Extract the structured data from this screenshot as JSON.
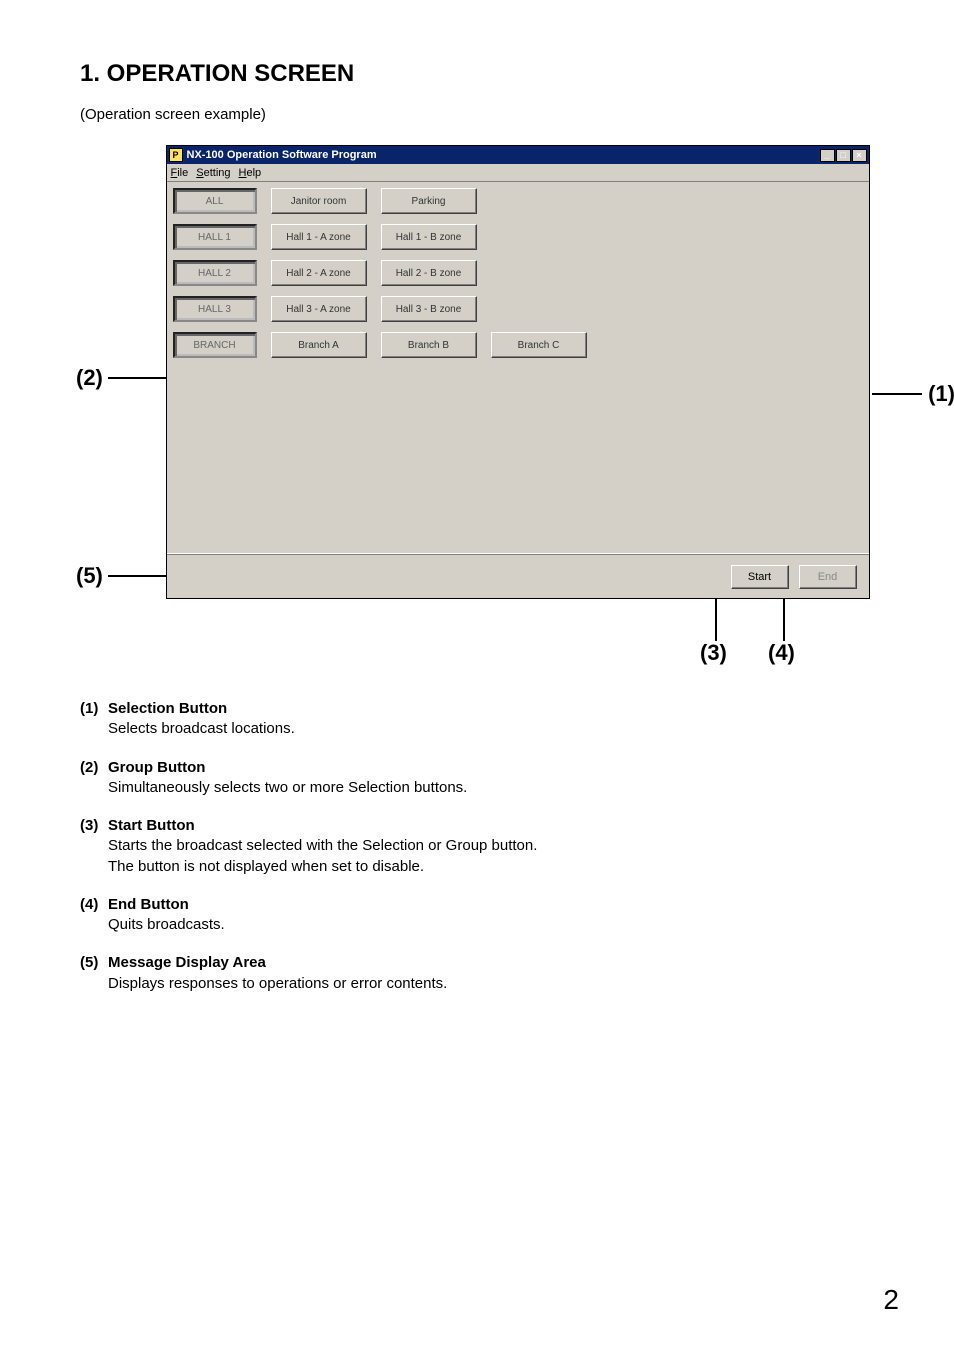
{
  "section": {
    "heading": "1. OPERATION SCREEN",
    "caption": "(Operation screen example)"
  },
  "app": {
    "icon_text": "P",
    "title": "NX-100 Operation Software Program",
    "menus": {
      "file": "File",
      "setting": "Setting",
      "help": "Help"
    },
    "rows": [
      {
        "group": "ALL",
        "sel": [
          "Janitor room",
          "Parking"
        ]
      },
      {
        "group": "HALL 1",
        "sel": [
          "Hall 1 - A zone",
          "Hall 1 - B zone"
        ]
      },
      {
        "group": "HALL 2",
        "sel": [
          "Hall 2 - A zone",
          "Hall 2 - B zone"
        ]
      },
      {
        "group": "HALL 3",
        "sel": [
          "Hall 3 - A zone",
          "Hall 3 - B zone"
        ]
      },
      {
        "group": "BRANCH",
        "sel": [
          "Branch A",
          "Branch B",
          "Branch C"
        ]
      }
    ],
    "actions": {
      "start": "Start",
      "end": "End"
    }
  },
  "callouts": {
    "c1": "(1)",
    "c2": "(2)",
    "c3": "(3)",
    "c4": "(4)",
    "c5": "(5)"
  },
  "descriptions": [
    {
      "num": "(1)",
      "title": "Selection Button",
      "body": "Selects broadcast locations."
    },
    {
      "num": "(2)",
      "title": "Group Button",
      "body": "Simultaneously selects two or more Selection buttons."
    },
    {
      "num": "(3)",
      "title": "Start Button",
      "body": "Starts the broadcast selected with the Selection or Group button.\nThe button is not displayed when set to disable."
    },
    {
      "num": "(4)",
      "title": "End Button",
      "body": "Quits broadcasts."
    },
    {
      "num": "(5)",
      "title": "Message Display Area",
      "body": "Displays responses to operations or error contents."
    }
  ],
  "page_number": "2"
}
